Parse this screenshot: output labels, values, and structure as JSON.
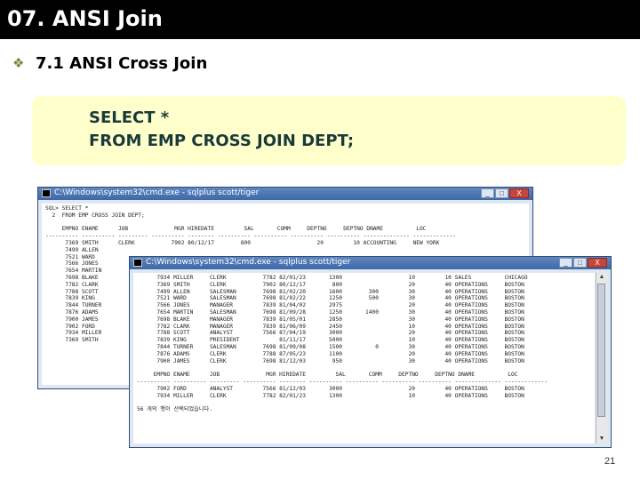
{
  "slide": {
    "title": "07. ANSI Join",
    "bullet_icon": "diamond-bullet-icon",
    "bullet": "7.1 ANSI Cross Join",
    "code": [
      "SELECT *",
      "FROM EMP CROSS JOIN DEPT;"
    ],
    "page_number": "21"
  },
  "window_back": {
    "title": "C:\\Windows\\system32\\cmd.exe - sqlplus  scott/tiger",
    "buttons": [
      "_",
      "□",
      "X"
    ],
    "lines": [
      "SQL> SELECT *",
      "  2  FROM EMP CROSS JOIN DEPT;",
      "",
      "     EMPNO ENAME      JOB              MGR HIREDATE         SAL       COMM     DEPTNO     DEPTNO DNAME          LOC",
      "---------- ---------- --------- ---------- -------- ---------- ---------- ---------- ---------- -------------- -------------",
      "      7369 SMITH      CLERK           7902 80/12/17        800                    20         10 ACCOUNTING     NEW YORK",
      "      7499 ALLEN",
      "      7521 WARD",
      "      7566 JONES",
      "      7654 MARTIN",
      "      7698 BLAKE",
      "      7782 CLARK",
      "      7788 SCOTT",
      "      7839 KING",
      "      7844 TURNER",
      "      7876 ADAMS",
      "      7900 JAMES",
      "      7902 FORD",
      "      7934 MILLER",
      "      7369 SMITH"
    ]
  },
  "window_front": {
    "title": "C:\\Windows\\system32\\cmd.exe - sqlplus  scott/tiger",
    "buttons": [
      "_",
      "□",
      "X"
    ],
    "lines": [
      "      7934 MILLER     CLERK           7782 82/01/23       1300                    10         10 SALES          CHICAGO",
      "      7369 SMITH      CLERK           7902 80/12/17        800                    20         40 OPERATIONS     BOSTON",
      "      7499 ALLEN      SALESMAN        7698 81/02/20       1600        300         30         40 OPERATIONS     BOSTON",
      "      7521 WARD       SALESMAN        7698 81/02/22       1250        500         30         40 OPERATIONS     BOSTON",
      "      7566 JONES      MANAGER         7839 81/04/02       2975                    20         40 OPERATIONS     BOSTON",
      "      7654 MARTIN     SALESMAN        7698 81/09/28       1250       1400         30         40 OPERATIONS     BOSTON",
      "      7698 BLAKE      MANAGER         7839 81/05/01       2850                    30         40 OPERATIONS     BOSTON",
      "      7782 CLARK      MANAGER         7839 81/06/09       2450                    10         40 OPERATIONS     BOSTON",
      "      7788 SCOTT      ANALYST         7566 87/04/19       3000                    20         40 OPERATIONS     BOSTON",
      "      7839 KING       PRESIDENT            81/11/17       5000                    10         40 OPERATIONS     BOSTON",
      "      7844 TURNER     SALESMAN        7698 81/09/08       1500          0         30         40 OPERATIONS     BOSTON",
      "      7876 ADAMS      CLERK           7788 87/05/23       1100                    20         40 OPERATIONS     BOSTON",
      "      7900 JAMES      CLERK           7698 81/12/03        950                    30         40 OPERATIONS     BOSTON",
      "",
      "     EMPNO ENAME      JOB              MGR HIREDATE         SAL       COMM     DEPTNO     DEPTNO DNAME          LOC",
      "---------- ---------- --------- ---------- -------- ---------- ---------- ---------- ---------- -------------- -------------",
      "      7902 FORD       ANALYST         7566 81/12/03       3000                    20         40 OPERATIONS     BOSTON",
      "      7934 MILLER     CLERK           7782 82/01/23       1300                    10         40 OPERATIONS     BOSTON",
      "",
      "56 개의 행이 선택되었습니다."
    ]
  }
}
